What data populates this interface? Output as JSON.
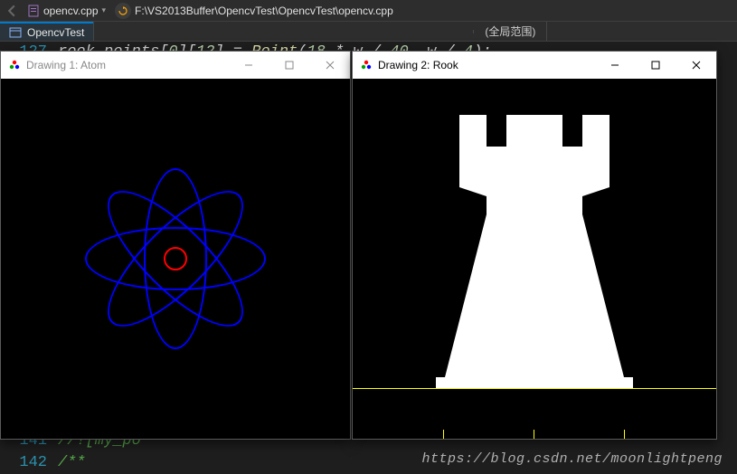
{
  "toolbar": {
    "active_file": "opencv.cpp",
    "path": "F:\\VS2013Buffer\\OpencvTest\\OpencvTest\\opencv.cpp"
  },
  "tab": {
    "name": "OpencvTest",
    "scope": "(全局范围)"
  },
  "code": {
    "line_top_num": "127",
    "line_top_text": "rook_points[0][12] = Point(18 * w / 40, w / 4);",
    "line_a_num": "141",
    "line_a_text": "//![my_po",
    "line_b_num": "142",
    "line_b_text": "/**"
  },
  "windows": {
    "atom": {
      "title": "Drawing 1: Atom"
    },
    "rook": {
      "title": "Drawing 2: Rook"
    }
  },
  "watermark": "https://blog.csdn.net/moonlightpeng",
  "colors": {
    "atom_orbit": "#0000ff",
    "atom_core": "#ff0000",
    "rook_fill": "#ffffff",
    "rook_box": "#ffff00"
  }
}
